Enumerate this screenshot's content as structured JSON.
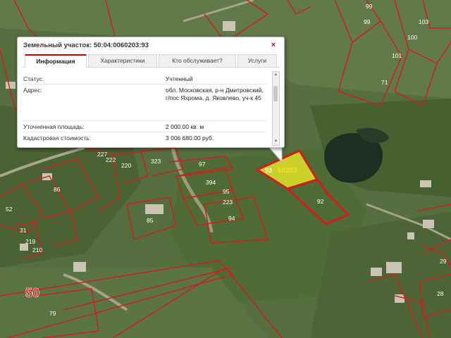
{
  "popup": {
    "title": "Земельный участок: 50:04:0060203:93",
    "close_icon": "×",
    "tabs": [
      {
        "label": "Информация",
        "active": true
      },
      {
        "label": "Характеристики",
        "active": false
      },
      {
        "label": "Кто обслуживает?",
        "active": false
      },
      {
        "label": "Услуги",
        "active": false
      }
    ],
    "fields": [
      {
        "key": "Статус:",
        "value": "Учтенный"
      },
      {
        "key": "Адрес:",
        "value": "обл. Московская, р-н Дмитровский, г/пос Яхрома, д. Яковлево, уч-к 45"
      },
      {
        "key": "Уточненная площадь:",
        "value": "2 000.00 кв. м"
      },
      {
        "key": "Кадастровая стоимость:",
        "value": "3 006 680.00 руб."
      }
    ]
  },
  "map": {
    "highlight_color": "#e6e629",
    "boundary_color": "#d21d1d",
    "selected_parcel_labels": [
      "93",
      "60203"
    ],
    "parcel_labels": [
      "99",
      "99",
      "100",
      "103",
      "101",
      "71",
      "92",
      "94",
      "95",
      "97",
      "394",
      "323",
      "85",
      "86",
      "52",
      "31",
      "219",
      "210",
      "222",
      "220",
      "227",
      "79",
      "29",
      "28",
      "223"
    ],
    "block_label": "50"
  }
}
